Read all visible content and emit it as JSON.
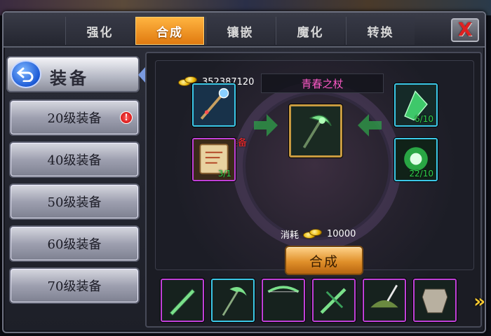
{
  "tabs": [
    {
      "label": "强化",
      "active": false
    },
    {
      "label": "合成",
      "active": true
    },
    {
      "label": "镶嵌",
      "active": false
    },
    {
      "label": "魔化",
      "active": false
    },
    {
      "label": "转换",
      "active": false
    }
  ],
  "close_label": "X",
  "category": {
    "title": "装备",
    "back_icon": "back-arrow-icon"
  },
  "levels": [
    {
      "label": "20级装备",
      "alert": "!"
    },
    {
      "label": "40级装备"
    },
    {
      "label": "50级装备"
    },
    {
      "label": "60级装备"
    },
    {
      "label": "70级装备"
    }
  ],
  "gold": {
    "amount": "352387120",
    "icon": "gold-coin-icon"
  },
  "item_name": "青春之杖",
  "select_hint": "点击选择装备",
  "materials": {
    "scroll_qty": "3/1",
    "crystal_qty": "6/10",
    "orb_qty": "22/10"
  },
  "cost": {
    "label": "消耗",
    "amount": "10000"
  },
  "combine_label": "合成",
  "bottom_items": [
    {
      "name": "green-dagger-icon"
    },
    {
      "name": "scythe-staff-icon"
    },
    {
      "name": "longbow-icon"
    },
    {
      "name": "crossbow-icon"
    },
    {
      "name": "feathered-hat-icon"
    },
    {
      "name": "armor-icon"
    }
  ],
  "colors": {
    "active_tab": "#f29a20",
    "item_name": "#ff5ac8",
    "hint": "#ff2a2a",
    "qty": "#2fd04a",
    "rare_border": "#c040d8",
    "blue_border": "#3cc8e8"
  }
}
